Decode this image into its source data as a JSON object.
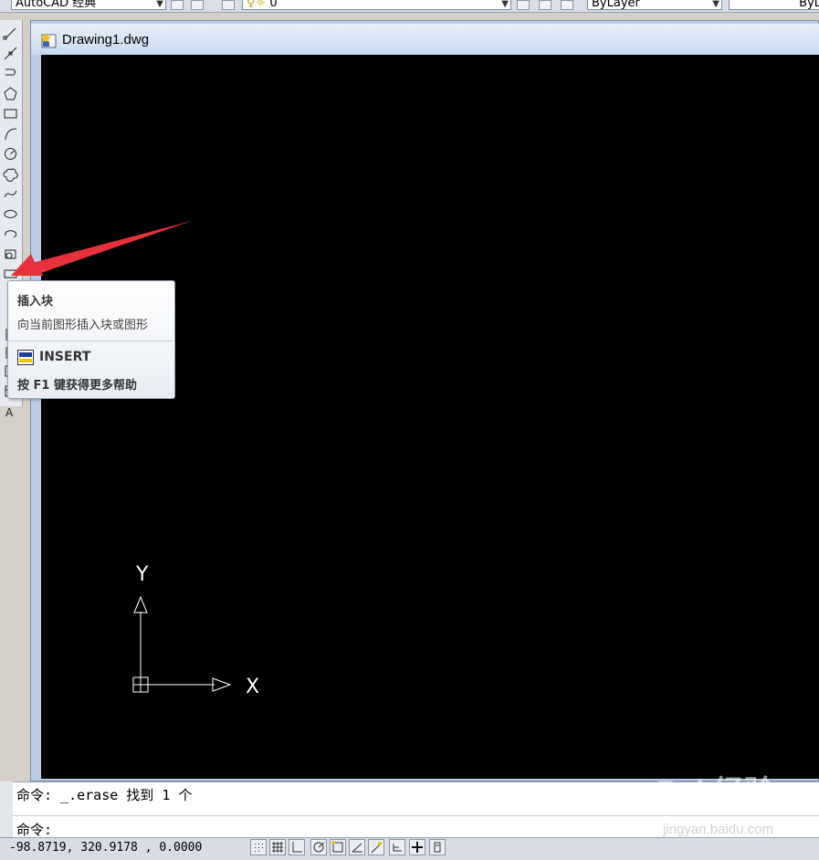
{
  "toolbar": {
    "workspace": "AutoCAD 经典",
    "layer_value": "0",
    "color_value": "ByLayer",
    "linetype_value": "ByLa"
  },
  "drawing": {
    "title": "Drawing1.dwg",
    "ucs_y_label": "Y",
    "ucs_x_label": "X"
  },
  "tooltip": {
    "title": "插入块",
    "description": "向当前图形插入块或图形",
    "command": "INSERT",
    "help": "按 F1 键获得更多帮助"
  },
  "command_line": {
    "history": "命令: _.erase 找到 1 个",
    "prompt": "命令:"
  },
  "status": {
    "coordinates": "-98.8719, 320.9178 , 0.0000"
  },
  "watermark": {
    "brand": "Bai 经验",
    "url": "jingyan.baidu.com"
  },
  "colors": {
    "canvas": "#000000",
    "arrow": "#e8313a",
    "tooltip_bg": "#ffffff"
  }
}
